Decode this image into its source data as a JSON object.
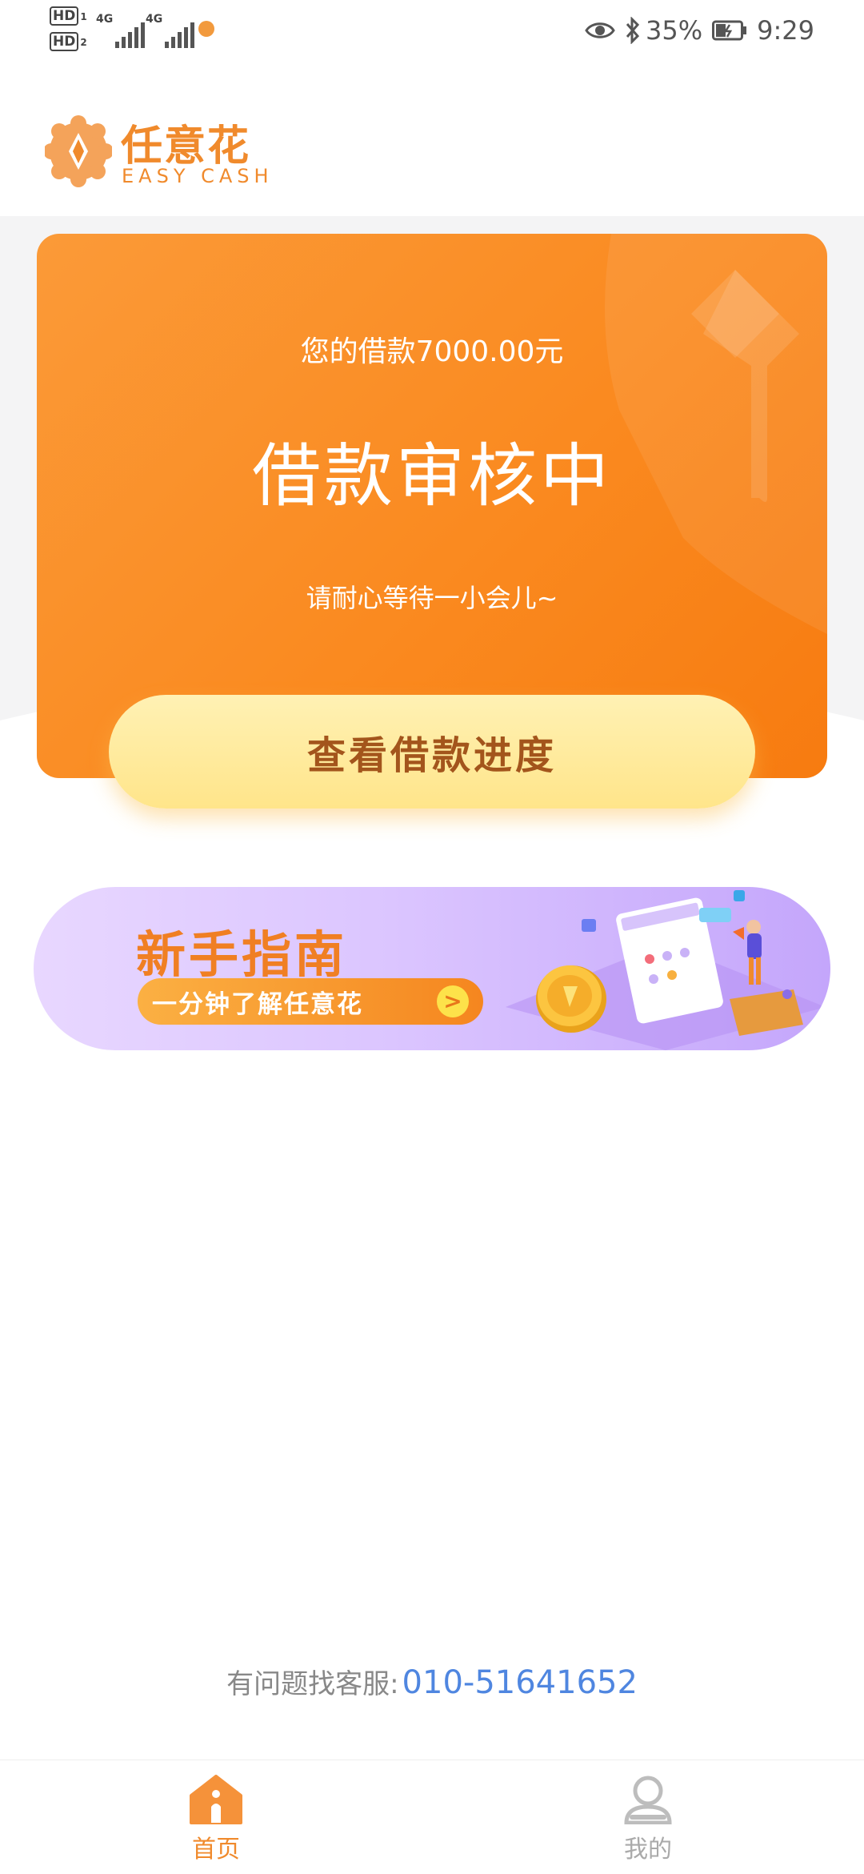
{
  "status_bar": {
    "hd1": "HD",
    "hd1_sub": "1",
    "hd2": "HD",
    "hd2_sub": "2",
    "network1": "4G",
    "network2": "4G",
    "battery": "35%",
    "time": "9:29"
  },
  "logo": {
    "name": "任意花",
    "subtitle": "EASY CASH"
  },
  "hero": {
    "amount_text": "您的借款7000.00元",
    "status_title": "借款审核中",
    "hint": "请耐心等待一小会儿~",
    "cta_label": "查看借款进度"
  },
  "guide_banner": {
    "title": "新手指南",
    "subtitle": "一分钟了解任意花",
    "arrow": ">"
  },
  "contact": {
    "label": "有问题找客服:",
    "phone": "010-51641652"
  },
  "nav": {
    "items": [
      {
        "label": "首页",
        "icon": "home-icon",
        "active": true
      },
      {
        "label": "我的",
        "icon": "profile-icon",
        "active": false
      }
    ]
  },
  "colors": {
    "brand_orange": "#f08a2c",
    "hero_gradient_start": "#fb9a38",
    "hero_gradient_end": "#f77b10",
    "cta_yellow": "#ffe58a",
    "cta_text": "#a3551c",
    "banner_purple": "#dbc5ff",
    "phone_blue": "#4f86e0"
  }
}
